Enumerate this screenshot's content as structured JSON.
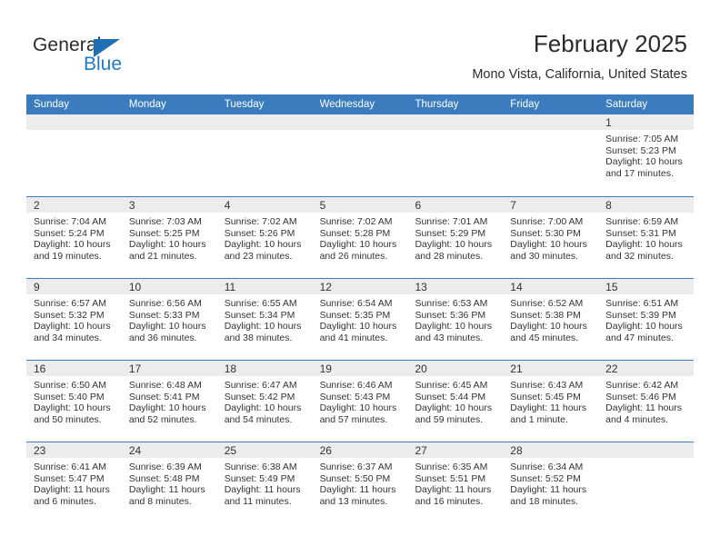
{
  "brand": {
    "name_part1": "General",
    "name_part2": "Blue"
  },
  "header": {
    "title": "February 2025",
    "location": "Mono Vista, California, United States"
  },
  "weekdays": [
    "Sunday",
    "Monday",
    "Tuesday",
    "Wednesday",
    "Thursday",
    "Friday",
    "Saturday"
  ],
  "colors": {
    "header_blue": "#3a7cbe",
    "logo_blue": "#1f7ac4",
    "day_band_gray": "#ececec",
    "text": "#333333"
  },
  "weeks": [
    [
      {
        "day": ""
      },
      {
        "day": ""
      },
      {
        "day": ""
      },
      {
        "day": ""
      },
      {
        "day": ""
      },
      {
        "day": ""
      },
      {
        "day": "1",
        "sunrise": "Sunrise: 7:05 AM",
        "sunset": "Sunset: 5:23 PM",
        "daylight": "Daylight: 10 hours and 17 minutes."
      }
    ],
    [
      {
        "day": "2",
        "sunrise": "Sunrise: 7:04 AM",
        "sunset": "Sunset: 5:24 PM",
        "daylight": "Daylight: 10 hours and 19 minutes."
      },
      {
        "day": "3",
        "sunrise": "Sunrise: 7:03 AM",
        "sunset": "Sunset: 5:25 PM",
        "daylight": "Daylight: 10 hours and 21 minutes."
      },
      {
        "day": "4",
        "sunrise": "Sunrise: 7:02 AM",
        "sunset": "Sunset: 5:26 PM",
        "daylight": "Daylight: 10 hours and 23 minutes."
      },
      {
        "day": "5",
        "sunrise": "Sunrise: 7:02 AM",
        "sunset": "Sunset: 5:28 PM",
        "daylight": "Daylight: 10 hours and 26 minutes."
      },
      {
        "day": "6",
        "sunrise": "Sunrise: 7:01 AM",
        "sunset": "Sunset: 5:29 PM",
        "daylight": "Daylight: 10 hours and 28 minutes."
      },
      {
        "day": "7",
        "sunrise": "Sunrise: 7:00 AM",
        "sunset": "Sunset: 5:30 PM",
        "daylight": "Daylight: 10 hours and 30 minutes."
      },
      {
        "day": "8",
        "sunrise": "Sunrise: 6:59 AM",
        "sunset": "Sunset: 5:31 PM",
        "daylight": "Daylight: 10 hours and 32 minutes."
      }
    ],
    [
      {
        "day": "9",
        "sunrise": "Sunrise: 6:57 AM",
        "sunset": "Sunset: 5:32 PM",
        "daylight": "Daylight: 10 hours and 34 minutes."
      },
      {
        "day": "10",
        "sunrise": "Sunrise: 6:56 AM",
        "sunset": "Sunset: 5:33 PM",
        "daylight": "Daylight: 10 hours and 36 minutes."
      },
      {
        "day": "11",
        "sunrise": "Sunrise: 6:55 AM",
        "sunset": "Sunset: 5:34 PM",
        "daylight": "Daylight: 10 hours and 38 minutes."
      },
      {
        "day": "12",
        "sunrise": "Sunrise: 6:54 AM",
        "sunset": "Sunset: 5:35 PM",
        "daylight": "Daylight: 10 hours and 41 minutes."
      },
      {
        "day": "13",
        "sunrise": "Sunrise: 6:53 AM",
        "sunset": "Sunset: 5:36 PM",
        "daylight": "Daylight: 10 hours and 43 minutes."
      },
      {
        "day": "14",
        "sunrise": "Sunrise: 6:52 AM",
        "sunset": "Sunset: 5:38 PM",
        "daylight": "Daylight: 10 hours and 45 minutes."
      },
      {
        "day": "15",
        "sunrise": "Sunrise: 6:51 AM",
        "sunset": "Sunset: 5:39 PM",
        "daylight": "Daylight: 10 hours and 47 minutes."
      }
    ],
    [
      {
        "day": "16",
        "sunrise": "Sunrise: 6:50 AM",
        "sunset": "Sunset: 5:40 PM",
        "daylight": "Daylight: 10 hours and 50 minutes."
      },
      {
        "day": "17",
        "sunrise": "Sunrise: 6:48 AM",
        "sunset": "Sunset: 5:41 PM",
        "daylight": "Daylight: 10 hours and 52 minutes."
      },
      {
        "day": "18",
        "sunrise": "Sunrise: 6:47 AM",
        "sunset": "Sunset: 5:42 PM",
        "daylight": "Daylight: 10 hours and 54 minutes."
      },
      {
        "day": "19",
        "sunrise": "Sunrise: 6:46 AM",
        "sunset": "Sunset: 5:43 PM",
        "daylight": "Daylight: 10 hours and 57 minutes."
      },
      {
        "day": "20",
        "sunrise": "Sunrise: 6:45 AM",
        "sunset": "Sunset: 5:44 PM",
        "daylight": "Daylight: 10 hours and 59 minutes."
      },
      {
        "day": "21",
        "sunrise": "Sunrise: 6:43 AM",
        "sunset": "Sunset: 5:45 PM",
        "daylight": "Daylight: 11 hours and 1 minute."
      },
      {
        "day": "22",
        "sunrise": "Sunrise: 6:42 AM",
        "sunset": "Sunset: 5:46 PM",
        "daylight": "Daylight: 11 hours and 4 minutes."
      }
    ],
    [
      {
        "day": "23",
        "sunrise": "Sunrise: 6:41 AM",
        "sunset": "Sunset: 5:47 PM",
        "daylight": "Daylight: 11 hours and 6 minutes."
      },
      {
        "day": "24",
        "sunrise": "Sunrise: 6:39 AM",
        "sunset": "Sunset: 5:48 PM",
        "daylight": "Daylight: 11 hours and 8 minutes."
      },
      {
        "day": "25",
        "sunrise": "Sunrise: 6:38 AM",
        "sunset": "Sunset: 5:49 PM",
        "daylight": "Daylight: 11 hours and 11 minutes."
      },
      {
        "day": "26",
        "sunrise": "Sunrise: 6:37 AM",
        "sunset": "Sunset: 5:50 PM",
        "daylight": "Daylight: 11 hours and 13 minutes."
      },
      {
        "day": "27",
        "sunrise": "Sunrise: 6:35 AM",
        "sunset": "Sunset: 5:51 PM",
        "daylight": "Daylight: 11 hours and 16 minutes."
      },
      {
        "day": "28",
        "sunrise": "Sunrise: 6:34 AM",
        "sunset": "Sunset: 5:52 PM",
        "daylight": "Daylight: 11 hours and 18 minutes."
      },
      {
        "day": ""
      }
    ]
  ]
}
